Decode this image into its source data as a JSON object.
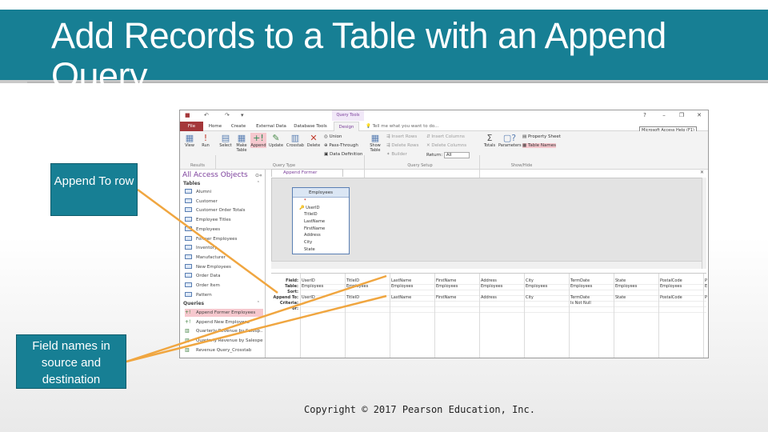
{
  "slide": {
    "title": "Add Records to a Table with an Append Query",
    "callout_append_to": "Append To row",
    "callout_field_names": "Field names in source and destination",
    "copyright": "Copyright © 2017 Pearson Education, Inc."
  },
  "colors": {
    "band": "#177f94",
    "access_accent": "#a4373a",
    "selected": "#f6c8ce",
    "context": "#7b3e9b"
  },
  "access": {
    "context_tab": "Query Tools",
    "tooltip": "Microsoft Access Help (F1)",
    "tabs": [
      "File",
      "Home",
      "Create",
      "External Data",
      "Database Tools",
      "Design"
    ],
    "active_tab": "Design",
    "tell_me": "Tell me what you want to do...",
    "ribbon": {
      "results": {
        "view": "View",
        "run": "Run",
        "group": "Results"
      },
      "query_type": {
        "select": "Select",
        "make_table": "Make Table",
        "append": "Append",
        "update": "Update",
        "crosstab": "Crosstab",
        "delete": "Delete",
        "union": "Union",
        "pass_through": "Pass-Through",
        "data_definition": "Data Definition",
        "group": "Query Type"
      },
      "query_setup": {
        "show_table": "Show Table",
        "insert_rows": "Insert Rows",
        "delete_rows": "Delete Rows",
        "builder": "Builder",
        "insert_columns": "Insert Columns",
        "delete_columns": "Delete Columns",
        "return_label": "Return:",
        "return_value": "All",
        "group": "Query Setup"
      },
      "show_hide": {
        "totals": "Totals",
        "parameters": "Parameters",
        "property_sheet": "Property Sheet",
        "table_names": "Table Names",
        "group": "Show/Hide"
      }
    },
    "nav": {
      "header": "All Access Objects",
      "tables_label": "Tables",
      "tables": [
        "Alumni",
        "Customer",
        "Customer Order Totals",
        "Employee Titles",
        "Employees",
        "Former Employees",
        "Inventory",
        "Manufacturer",
        "New Employees",
        "Order Data",
        "Order Item",
        "Pattern"
      ],
      "queries_label": "Queries",
      "queries": [
        "Append Former Employees",
        "Append New Employees",
        "Quarterly Revenue by Salesp...",
        "Quarterly Revenue by Salesper...",
        "Revenue Query_Crosstab"
      ],
      "selected_query": "Append Former Employees"
    },
    "doc_tab": "Append Former Employees",
    "source_table": {
      "name": "Employees",
      "fields": [
        "*",
        "UserID",
        "TitleID",
        "LastName",
        "FirstName",
        "Address",
        "City",
        "State"
      ]
    },
    "grid": {
      "row_labels": [
        "Field:",
        "Table:",
        "Sort:",
        "Append To:",
        "Criteria:",
        "or:"
      ],
      "columns": [
        {
          "field": "UserID",
          "table": "Employees",
          "append_to": "UserID",
          "criteria": ""
        },
        {
          "field": "TitleID",
          "table": "Employees",
          "append_to": "TitleID",
          "criteria": ""
        },
        {
          "field": "LastName",
          "table": "Employees",
          "append_to": "LastName",
          "criteria": ""
        },
        {
          "field": "FirstName",
          "table": "Employees",
          "append_to": "FirstName",
          "criteria": ""
        },
        {
          "field": "Address",
          "table": "Employees",
          "append_to": "Address",
          "criteria": ""
        },
        {
          "field": "City",
          "table": "Employees",
          "append_to": "City",
          "criteria": ""
        },
        {
          "field": "TermDate",
          "table": "Employees",
          "append_to": "TermDate",
          "criteria": "Is Not Null"
        },
        {
          "field": "State",
          "table": "Employees",
          "append_to": "State",
          "criteria": ""
        },
        {
          "field": "PostalCode",
          "table": "Employees",
          "append_to": "PostalCode",
          "criteria": ""
        },
        {
          "field": "P",
          "table": "E",
          "append_to": "P",
          "criteria": ""
        }
      ]
    }
  }
}
